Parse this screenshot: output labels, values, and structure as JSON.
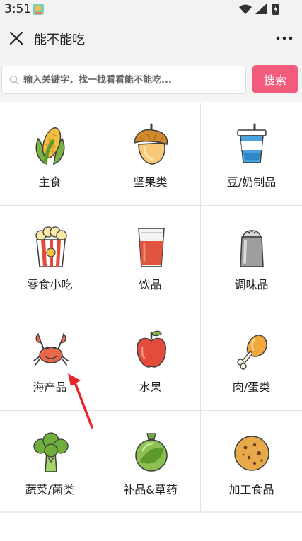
{
  "status_bar": {
    "time": "3:51"
  },
  "titlebar": {
    "title": "能不能吃"
  },
  "search": {
    "placeholder": "输入关键字，找一找看看能不能吃...",
    "button_label": "搜索"
  },
  "categories": [
    {
      "label": "主食",
      "icon": "corn-icon"
    },
    {
      "label": "坚果类",
      "icon": "acorn-icon"
    },
    {
      "label": "豆/奶制品",
      "icon": "yogurt-cup-icon"
    },
    {
      "label": "零食小吃",
      "icon": "popcorn-icon"
    },
    {
      "label": "饮品",
      "icon": "drink-glass-icon"
    },
    {
      "label": "调味品",
      "icon": "salt-shaker-icon"
    },
    {
      "label": "海产品",
      "icon": "crab-icon"
    },
    {
      "label": "水果",
      "icon": "apple-icon"
    },
    {
      "label": "肉/蛋类",
      "icon": "drumstick-icon"
    },
    {
      "label": "蔬菜/菌类",
      "icon": "broccoli-icon"
    },
    {
      "label": "补品&草药",
      "icon": "herb-ball-icon"
    },
    {
      "label": "加工食品",
      "icon": "cookie-icon"
    }
  ],
  "colors": {
    "accent": "#f25b7b",
    "background": "#f2f2f2",
    "grid_line": "#e3e3e3",
    "annotation_arrow": "#e8262a"
  }
}
